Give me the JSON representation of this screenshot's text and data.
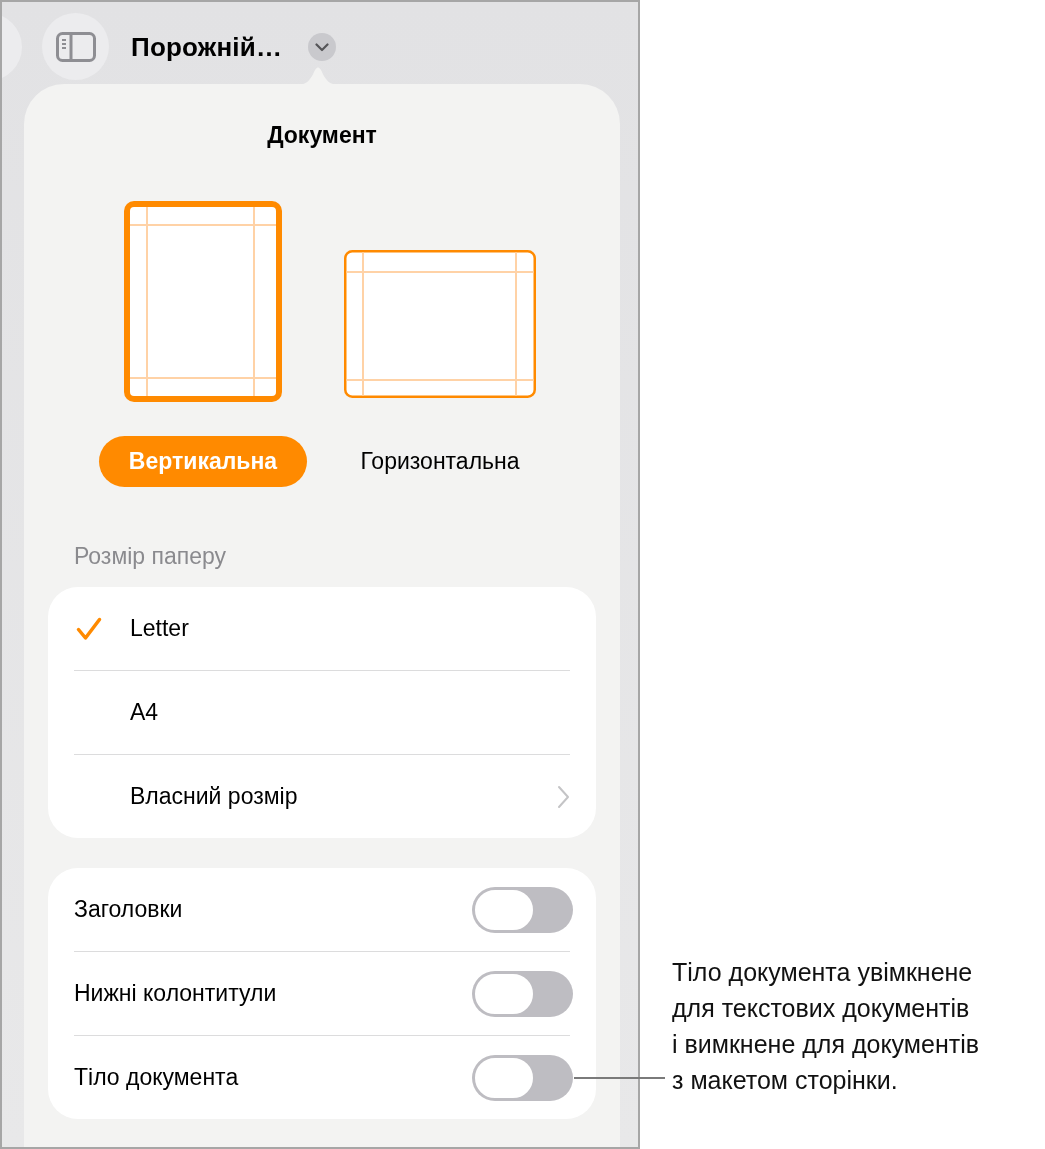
{
  "toolbar": {
    "title": "Порожній…"
  },
  "popover": {
    "title": "Документ",
    "orientations": [
      {
        "kind": "portrait",
        "label": "Вертикальна",
        "selected": true
      },
      {
        "kind": "landscape",
        "label": "Горизонтальна",
        "selected": false
      }
    ],
    "paper_size": {
      "heading": "Розмір паперу",
      "options": [
        {
          "kind": "option",
          "label": "Letter",
          "selected": true
        },
        {
          "kind": "option",
          "label": "A4",
          "selected": false
        },
        {
          "kind": "disclosure",
          "label": "Власний розмір",
          "selected": false
        }
      ]
    },
    "toggles": [
      {
        "label": "Заголовки",
        "on": false
      },
      {
        "label": "Нижні колонтитули",
        "on": false
      },
      {
        "label": "Тіло документа",
        "on": false
      }
    ]
  },
  "callout": {
    "text": "Тіло документа увімкнене\nдля текстових документів\nі вимкнене для документів\nз макетом сторінки."
  }
}
